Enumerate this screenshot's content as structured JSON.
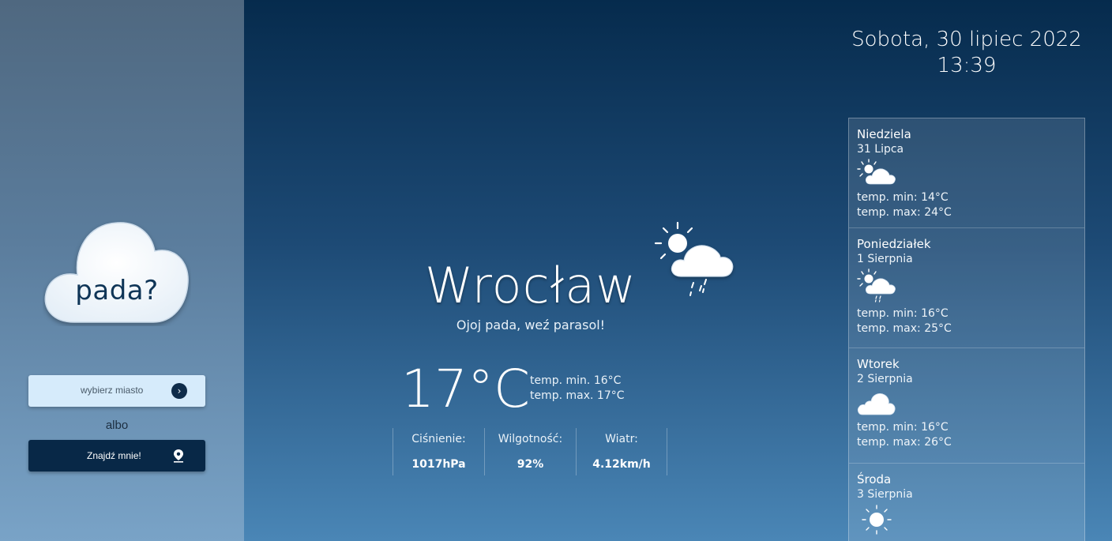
{
  "sidebar": {
    "logo_text": "pada?",
    "city_select_label": "wybierz miasto",
    "or_text": "albo",
    "locate_label": "Znajdź mnie!"
  },
  "header": {
    "date": "Sobota, 30 lipiec 2022",
    "time": "13:39"
  },
  "current": {
    "city": "Wrocław",
    "message": "Ojoj pada, weź parasol!",
    "temperature": "17°C",
    "temp_min": "temp. min. 16°C",
    "temp_max": "temp. max. 17°C",
    "icon": "sun-cloud-rain-icon",
    "stats": [
      {
        "label": "Ciśnienie:",
        "value": "1017hPa"
      },
      {
        "label": "Wilgotność:",
        "value": "92%"
      },
      {
        "label": "Wiatr:",
        "value": "4.12km/h"
      }
    ]
  },
  "forecast": [
    {
      "day": "Niedziela",
      "date": "31 Lipca",
      "icon": "sun-cloud-icon",
      "min": "temp. min: 14°C",
      "max": "temp. max: 24°C"
    },
    {
      "day": "Poniedziałek",
      "date": "1 Sierpnia",
      "icon": "sun-cloud-rain-icon",
      "min": "temp. min: 16°C",
      "max": "temp. max: 25°C"
    },
    {
      "day": "Wtorek",
      "date": "2 Sierpnia",
      "icon": "cloud-icon",
      "min": "temp. min: 16°C",
      "max": "temp. max: 26°C"
    },
    {
      "day": "Środa",
      "date": "3 Sierpnia",
      "icon": "sun-icon",
      "min": "",
      "max": ""
    }
  ],
  "colors": {
    "navy": "#082847",
    "select_bg": "#d6ebfb",
    "logo_text": "#0f3557"
  }
}
